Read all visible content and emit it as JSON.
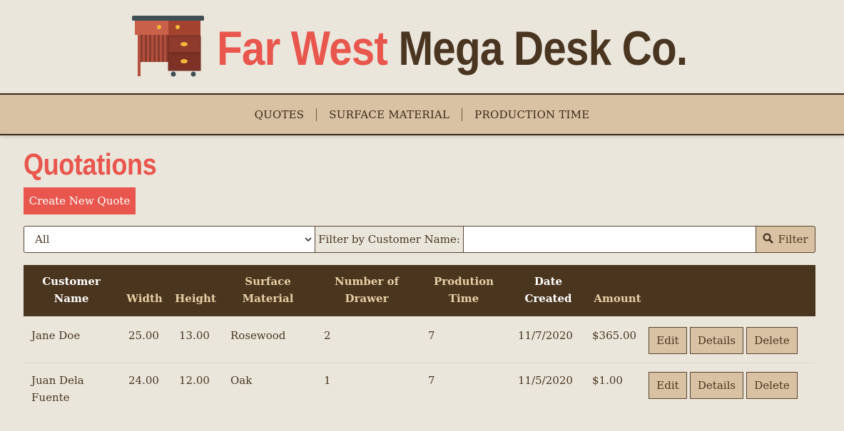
{
  "brand": {
    "title_part1": "Far West",
    "title_part2": "Mega Desk Co.",
    "accent_color": "#e8564d",
    "dark_color": "#4a3520"
  },
  "nav": {
    "items": [
      "QUOTES",
      "SURFACE MATERIAL",
      "PRODUCTION TIME"
    ]
  },
  "main": {
    "title": "Quotations",
    "create_button": "Create New Quote"
  },
  "filter": {
    "select_value": "All",
    "label": "Filter by Customer Name:",
    "input_value": "",
    "button_label": "Filter",
    "button_icon": "search-icon"
  },
  "table": {
    "headers": {
      "customer_name": [
        "Customer",
        "Name"
      ],
      "width": "Width",
      "height": "Height",
      "surface_material": [
        "Surface",
        "Material"
      ],
      "number_of_drawer": [
        "Number of",
        "Drawer"
      ],
      "production_time": [
        "Prodution",
        "Time"
      ],
      "date_created": [
        "Date",
        "Created"
      ],
      "amount": "Amount"
    },
    "rows": [
      {
        "customer_name": "Jane Doe",
        "width": "25.00",
        "height": "13.00",
        "surface_material": "Rosewood",
        "drawers": "2",
        "production_time": "7",
        "date_created": "11/7/2020",
        "amount": "$365.00"
      },
      {
        "customer_name": "Juan Dela Fuente",
        "width": "24.00",
        "height": "12.00",
        "surface_material": "Oak",
        "drawers": "1",
        "production_time": "7",
        "date_created": "11/5/2020",
        "amount": "$1.00"
      }
    ],
    "actions": {
      "edit": "Edit",
      "details": "Details",
      "delete": "Delete"
    }
  }
}
